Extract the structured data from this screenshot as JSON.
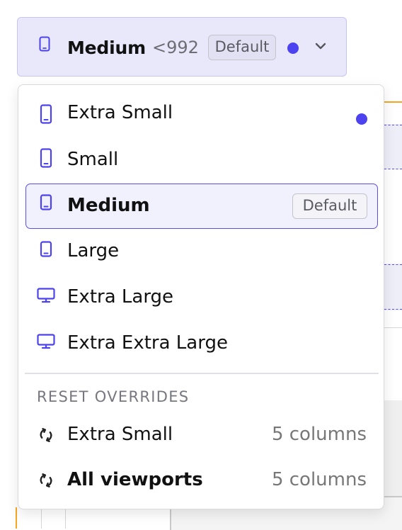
{
  "colors": {
    "accent": "#4c42ef",
    "trigger_bg": "#e9e8fb",
    "selected_border": "#5b4fe3"
  },
  "trigger": {
    "icon": "tablet-icon",
    "label": "Medium",
    "size": "<992",
    "badge": "Default",
    "has_override_dot": true,
    "chevron": "chevron-down-icon"
  },
  "menu": {
    "items": [
      {
        "icon": "phone-icon",
        "label": "Extra Small",
        "override_dot": true
      },
      {
        "icon": "phone-icon",
        "label": "Small"
      },
      {
        "icon": "tablet-icon",
        "label": "Medium",
        "badge": "Default",
        "selected": true
      },
      {
        "icon": "tablet-icon",
        "label": "Large"
      },
      {
        "icon": "desktop-icon",
        "label": "Extra Large"
      },
      {
        "icon": "desktop-icon",
        "label": "Extra Extra Large"
      }
    ],
    "reset_heading": "RESET OVERRIDES",
    "reset_items": [
      {
        "icon": "reset-icon",
        "label": "Extra Small",
        "value": "5 columns"
      },
      {
        "icon": "reset-icon",
        "label": "All viewports",
        "value": "5 columns"
      }
    ]
  }
}
